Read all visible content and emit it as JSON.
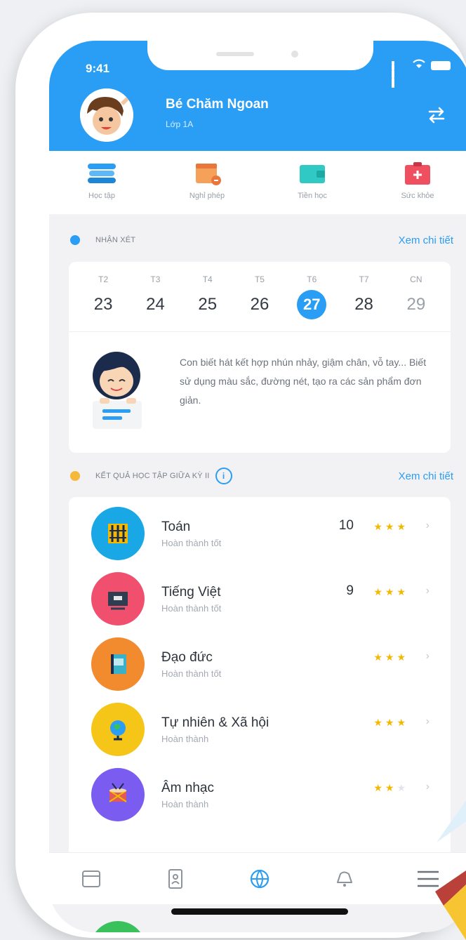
{
  "status_bar": {
    "time": "9:41"
  },
  "profile": {
    "name": "Bé Chăm Ngoan",
    "class": "Lớp 1A"
  },
  "quick_menu": [
    {
      "label": "Học tập",
      "icon": "books-icon"
    },
    {
      "label": "Nghỉ phép",
      "icon": "calendar-leave-icon"
    },
    {
      "label": "Tiền học",
      "icon": "wallet-icon"
    },
    {
      "label": "Sức khỏe",
      "icon": "first-aid-icon"
    }
  ],
  "review": {
    "title": "NHẬN XÉT",
    "see_more": "Xem chi tiết",
    "days": [
      {
        "name": "T2",
        "num": "23"
      },
      {
        "name": "T3",
        "num": "24"
      },
      {
        "name": "T4",
        "num": "25"
      },
      {
        "name": "T5",
        "num": "26"
      },
      {
        "name": "T6",
        "num": "27",
        "active": true
      },
      {
        "name": "T7",
        "num": "28"
      },
      {
        "name": "CN",
        "num": "29",
        "muted": true
      }
    ],
    "comment": "Con biết hát kết hợp nhún nhảy, giậm chân, vỗ tay... Biết sử dụng màu sắc, đường nét, tạo ra các sản phẩm đơn giản."
  },
  "results": {
    "title": "KẾT QUẢ HỌC TẬP GIỮA KỲ II",
    "see_more": "Xem chi tiết",
    "info_glyph": "i",
    "subjects": [
      {
        "name": "Toán",
        "status": "Hoàn thành tốt",
        "score": "10",
        "stars": 3,
        "color": "#1aa7e6",
        "icon": "abacus-icon"
      },
      {
        "name": "Tiếng Việt",
        "status": "Hoàn thành tốt",
        "score": "9",
        "stars": 3,
        "color": "#f0506e",
        "icon": "blackboard-icon"
      },
      {
        "name": "Đạo đức",
        "status": "Hoàn thành tốt",
        "score": "",
        "stars": 3,
        "color": "#f28a2e",
        "icon": "book-icon"
      },
      {
        "name": "Tự nhiên & Xã hội",
        "status": "Hoàn thành",
        "score": "",
        "stars": 3,
        "color": "#f5c518",
        "icon": "globe-icon"
      },
      {
        "name": "Âm nhạc",
        "status": "Hoàn thành",
        "score": "",
        "stars": 2,
        "color": "#7b5cf0",
        "icon": "drum-icon"
      }
    ],
    "stars_max": 3
  },
  "bottom_nav": [
    {
      "icon": "calendar-icon"
    },
    {
      "icon": "phone-book-icon"
    },
    {
      "icon": "globe-nav-icon"
    },
    {
      "icon": "bell-icon"
    },
    {
      "icon": "menu-icon"
    }
  ],
  "colors": {
    "primary": "#2a9df4",
    "star": "#f5b800",
    "review_dot": "#2a9df4",
    "results_dot": "#f5b83a"
  }
}
